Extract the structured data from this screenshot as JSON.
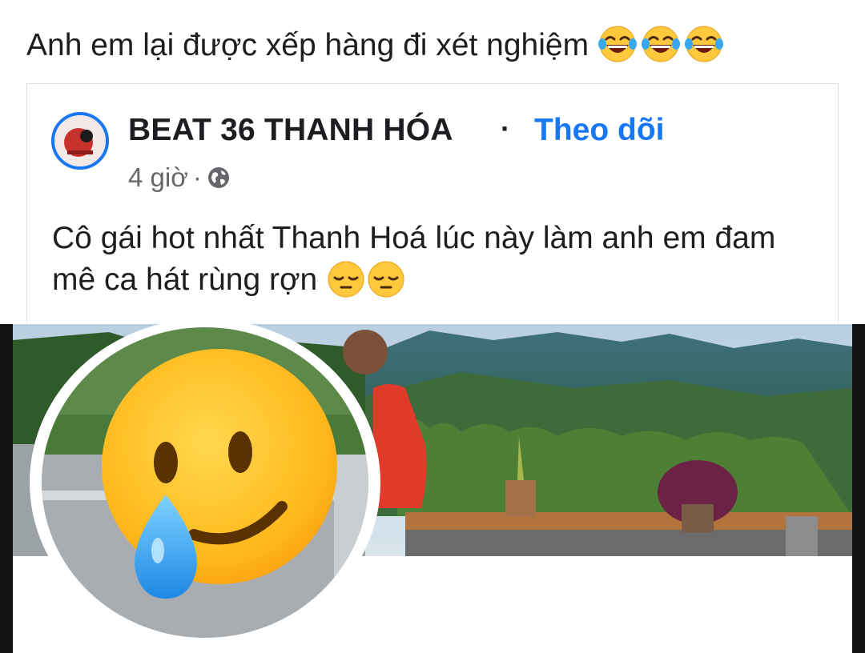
{
  "post": {
    "caption": "Anh em lại được xếp hàng đi xét nghiệm",
    "caption_emojis": [
      "face-with-tears-of-joy-icon",
      "face-with-tears-of-joy-icon",
      "face-with-tears-of-joy-icon"
    ]
  },
  "shared_post": {
    "page_name": "BEAT 36 THANH HÓA",
    "separator": "·",
    "follow_label": "Theo dõi",
    "time": "4 giờ",
    "meta_separator": "·",
    "privacy_icon": "globe-icon",
    "text": "Cô gái hot nhất Thanh Hoá lúc này làm anh em đam mê ca hát rùng rợn",
    "text_emojis": [
      "pensive-face-icon",
      "pensive-face-icon"
    ]
  },
  "media": {
    "profile_sticker": "smiling-face-with-tear-icon"
  },
  "colors": {
    "link_blue": "#1877f2",
    "secondary_text": "#65676b",
    "emoji_yellow": "#ffc83d"
  }
}
